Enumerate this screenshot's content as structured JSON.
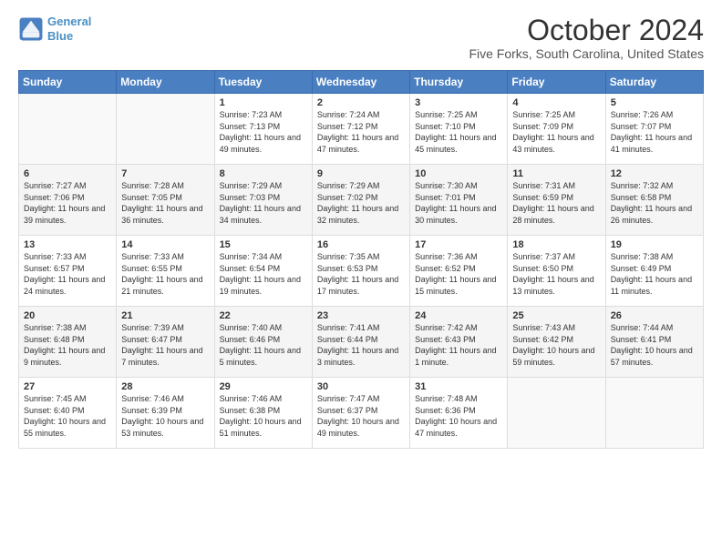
{
  "header": {
    "logo_line1": "General",
    "logo_line2": "Blue",
    "month_title": "October 2024",
    "location": "Five Forks, South Carolina, United States"
  },
  "weekdays": [
    "Sunday",
    "Monday",
    "Tuesday",
    "Wednesday",
    "Thursday",
    "Friday",
    "Saturday"
  ],
  "weeks": [
    [
      {
        "day": "",
        "info": ""
      },
      {
        "day": "",
        "info": ""
      },
      {
        "day": "1",
        "info": "Sunrise: 7:23 AM\nSunset: 7:13 PM\nDaylight: 11 hours and 49 minutes."
      },
      {
        "day": "2",
        "info": "Sunrise: 7:24 AM\nSunset: 7:12 PM\nDaylight: 11 hours and 47 minutes."
      },
      {
        "day": "3",
        "info": "Sunrise: 7:25 AM\nSunset: 7:10 PM\nDaylight: 11 hours and 45 minutes."
      },
      {
        "day": "4",
        "info": "Sunrise: 7:25 AM\nSunset: 7:09 PM\nDaylight: 11 hours and 43 minutes."
      },
      {
        "day": "5",
        "info": "Sunrise: 7:26 AM\nSunset: 7:07 PM\nDaylight: 11 hours and 41 minutes."
      }
    ],
    [
      {
        "day": "6",
        "info": "Sunrise: 7:27 AM\nSunset: 7:06 PM\nDaylight: 11 hours and 39 minutes."
      },
      {
        "day": "7",
        "info": "Sunrise: 7:28 AM\nSunset: 7:05 PM\nDaylight: 11 hours and 36 minutes."
      },
      {
        "day": "8",
        "info": "Sunrise: 7:29 AM\nSunset: 7:03 PM\nDaylight: 11 hours and 34 minutes."
      },
      {
        "day": "9",
        "info": "Sunrise: 7:29 AM\nSunset: 7:02 PM\nDaylight: 11 hours and 32 minutes."
      },
      {
        "day": "10",
        "info": "Sunrise: 7:30 AM\nSunset: 7:01 PM\nDaylight: 11 hours and 30 minutes."
      },
      {
        "day": "11",
        "info": "Sunrise: 7:31 AM\nSunset: 6:59 PM\nDaylight: 11 hours and 28 minutes."
      },
      {
        "day": "12",
        "info": "Sunrise: 7:32 AM\nSunset: 6:58 PM\nDaylight: 11 hours and 26 minutes."
      }
    ],
    [
      {
        "day": "13",
        "info": "Sunrise: 7:33 AM\nSunset: 6:57 PM\nDaylight: 11 hours and 24 minutes."
      },
      {
        "day": "14",
        "info": "Sunrise: 7:33 AM\nSunset: 6:55 PM\nDaylight: 11 hours and 21 minutes."
      },
      {
        "day": "15",
        "info": "Sunrise: 7:34 AM\nSunset: 6:54 PM\nDaylight: 11 hours and 19 minutes."
      },
      {
        "day": "16",
        "info": "Sunrise: 7:35 AM\nSunset: 6:53 PM\nDaylight: 11 hours and 17 minutes."
      },
      {
        "day": "17",
        "info": "Sunrise: 7:36 AM\nSunset: 6:52 PM\nDaylight: 11 hours and 15 minutes."
      },
      {
        "day": "18",
        "info": "Sunrise: 7:37 AM\nSunset: 6:50 PM\nDaylight: 11 hours and 13 minutes."
      },
      {
        "day": "19",
        "info": "Sunrise: 7:38 AM\nSunset: 6:49 PM\nDaylight: 11 hours and 11 minutes."
      }
    ],
    [
      {
        "day": "20",
        "info": "Sunrise: 7:38 AM\nSunset: 6:48 PM\nDaylight: 11 hours and 9 minutes."
      },
      {
        "day": "21",
        "info": "Sunrise: 7:39 AM\nSunset: 6:47 PM\nDaylight: 11 hours and 7 minutes."
      },
      {
        "day": "22",
        "info": "Sunrise: 7:40 AM\nSunset: 6:46 PM\nDaylight: 11 hours and 5 minutes."
      },
      {
        "day": "23",
        "info": "Sunrise: 7:41 AM\nSunset: 6:44 PM\nDaylight: 11 hours and 3 minutes."
      },
      {
        "day": "24",
        "info": "Sunrise: 7:42 AM\nSunset: 6:43 PM\nDaylight: 11 hours and 1 minute."
      },
      {
        "day": "25",
        "info": "Sunrise: 7:43 AM\nSunset: 6:42 PM\nDaylight: 10 hours and 59 minutes."
      },
      {
        "day": "26",
        "info": "Sunrise: 7:44 AM\nSunset: 6:41 PM\nDaylight: 10 hours and 57 minutes."
      }
    ],
    [
      {
        "day": "27",
        "info": "Sunrise: 7:45 AM\nSunset: 6:40 PM\nDaylight: 10 hours and 55 minutes."
      },
      {
        "day": "28",
        "info": "Sunrise: 7:46 AM\nSunset: 6:39 PM\nDaylight: 10 hours and 53 minutes."
      },
      {
        "day": "29",
        "info": "Sunrise: 7:46 AM\nSunset: 6:38 PM\nDaylight: 10 hours and 51 minutes."
      },
      {
        "day": "30",
        "info": "Sunrise: 7:47 AM\nSunset: 6:37 PM\nDaylight: 10 hours and 49 minutes."
      },
      {
        "day": "31",
        "info": "Sunrise: 7:48 AM\nSunset: 6:36 PM\nDaylight: 10 hours and 47 minutes."
      },
      {
        "day": "",
        "info": ""
      },
      {
        "day": "",
        "info": ""
      }
    ]
  ]
}
